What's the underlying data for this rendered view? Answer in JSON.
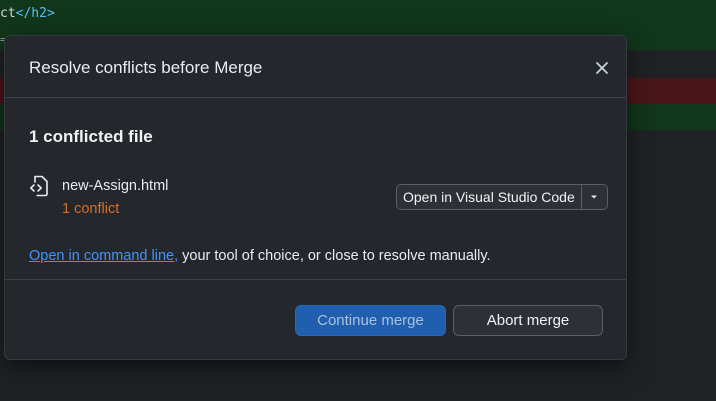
{
  "background": {
    "code_line_1_text": "ct",
    "code_line_1_tag": "</h2>",
    "code_line_2_text": "="
  },
  "dialog": {
    "title": "Resolve conflicts before Merge",
    "close_icon": "close-icon",
    "section_heading": "1 conflicted file",
    "file": {
      "icon": "file-code-icon",
      "name": "new-Assign.html",
      "conflict_count": "1 conflict",
      "open_button_label": "Open in Visual Studio Code",
      "dropdown_icon": "chevron-down-icon"
    },
    "help": {
      "link_text": "Open in command line,",
      "rest_text": " your tool of choice, or close to resolve manually."
    },
    "buttons": {
      "continue_label": "Continue merge",
      "abort_label": "Abort merge"
    }
  },
  "colors": {
    "accent_blue": "#1f5fae",
    "link_blue": "#4493f8",
    "conflict_orange": "#db6d28",
    "dialog_bg": "#24272b"
  }
}
